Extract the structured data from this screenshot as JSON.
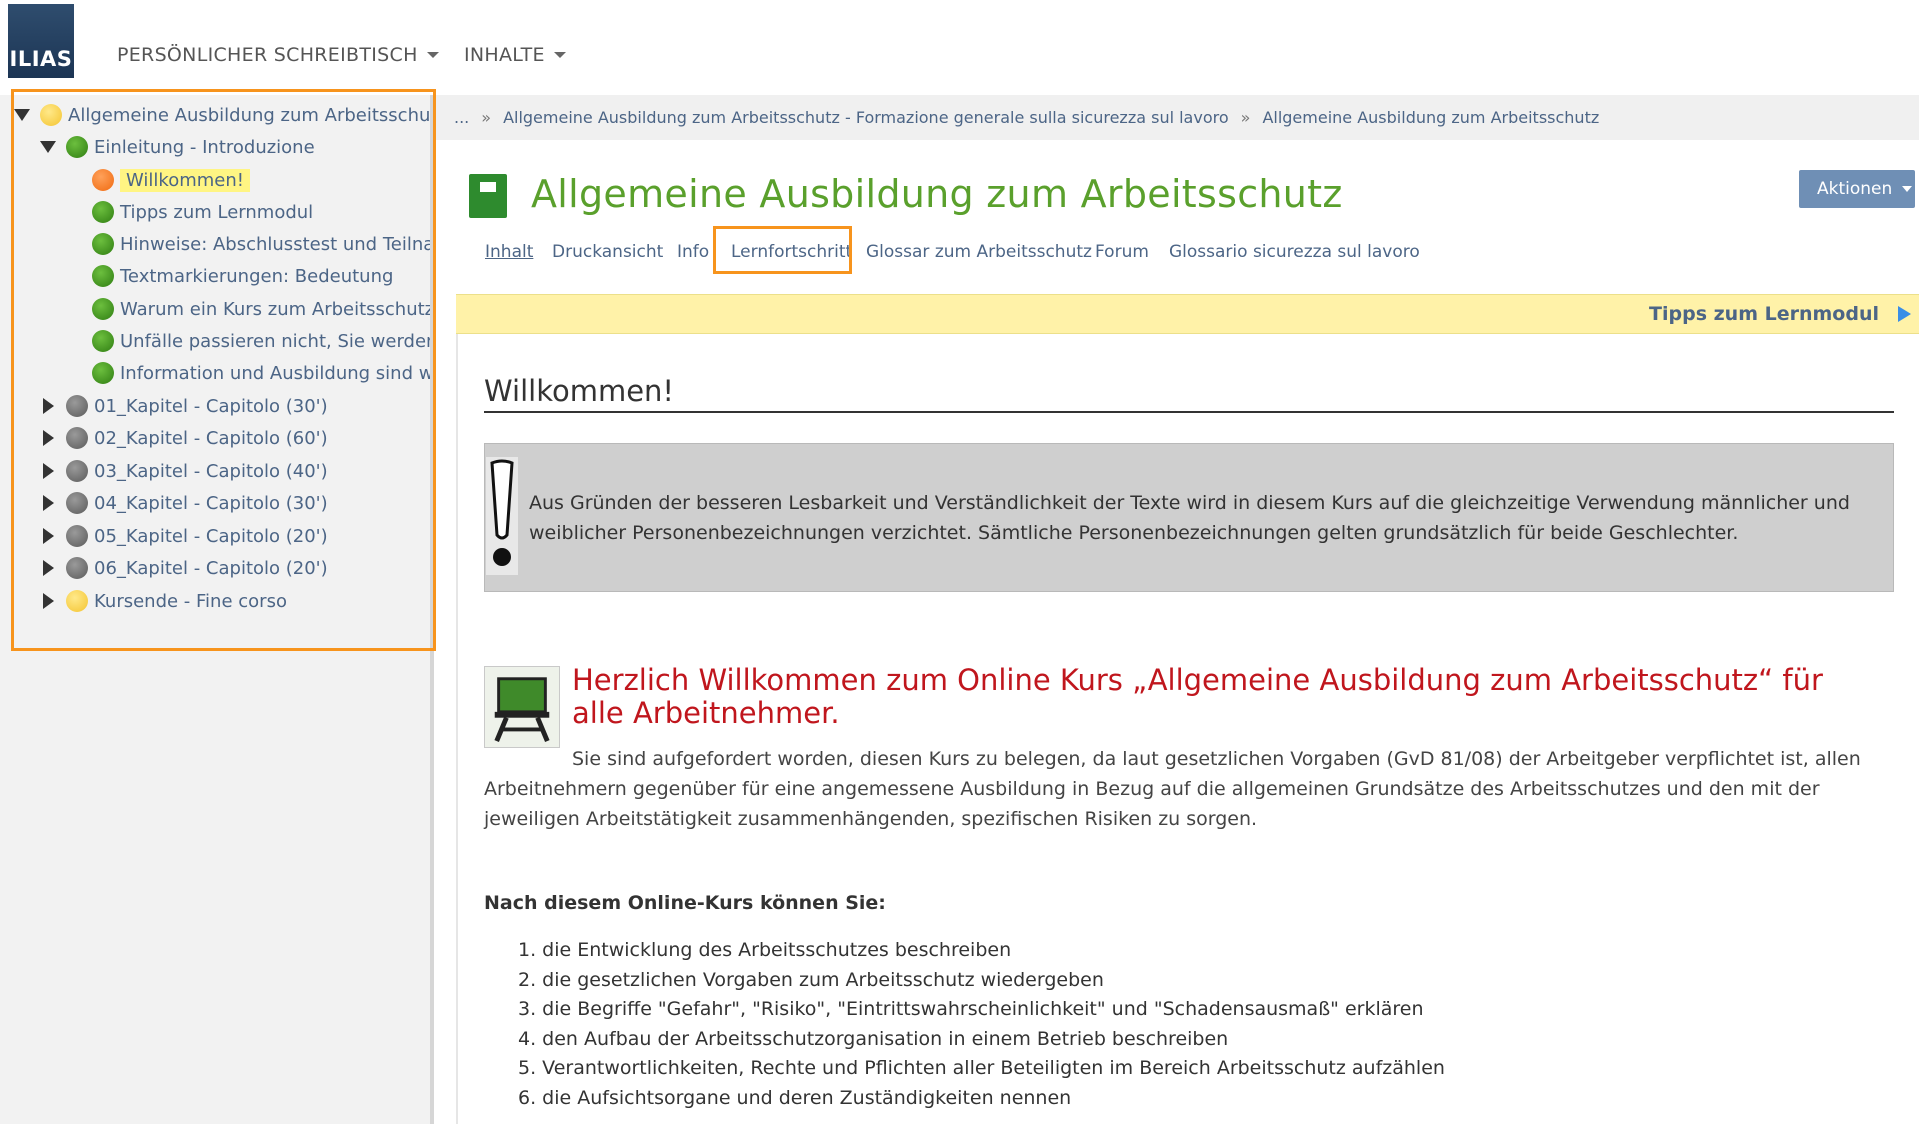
{
  "app": {
    "logo_text": "ILIAS"
  },
  "topnav": [
    {
      "label": "PERSÖNLICHER SCHREIBTISCH"
    },
    {
      "label": "INHALTE"
    }
  ],
  "tree": {
    "root": {
      "label": "Allgemeine Ausbildung zum Arbeitsschutz",
      "status": "yellow"
    },
    "chapter_intro": {
      "label": "Einleitung - Introduzione",
      "status": "green"
    },
    "pages": [
      {
        "label": "Willkommen!",
        "status": "orange",
        "current": true
      },
      {
        "label": "Tipps zum Lernmodul",
        "status": "green"
      },
      {
        "label": "Hinweise: Abschlusstest und Teilnahı",
        "status": "green"
      },
      {
        "label": "Textmarkierungen: Bedeutung",
        "status": "green"
      },
      {
        "label": "Warum ein Kurs zum Arbeitsschutz?",
        "status": "green"
      },
      {
        "label": "Unfälle passieren nicht, Sie werden v",
        "status": "green"
      },
      {
        "label": "Information und Ausbildung sind wic",
        "status": "green"
      }
    ],
    "chapters": [
      {
        "label": "01_Kapitel - Capitolo (30')",
        "status": "grey"
      },
      {
        "label": "02_Kapitel - Capitolo (60')",
        "status": "grey"
      },
      {
        "label": "03_Kapitel - Capitolo (40')",
        "status": "grey"
      },
      {
        "label": "04_Kapitel - Capitolo (30')",
        "status": "grey"
      },
      {
        "label": "05_Kapitel - Capitolo (20')",
        "status": "grey"
      },
      {
        "label": "06_Kapitel - Capitolo (20')",
        "status": "grey"
      },
      {
        "label": "Kursende - Fine corso",
        "status": "yellow"
      }
    ]
  },
  "breadcrumb": {
    "ellipsis": "...",
    "separator": "»",
    "items": [
      "Allgemeine Ausbildung zum Arbeitsschutz - Formazione generale sulla sicurezza sul lavoro",
      "Allgemeine Ausbildung zum Arbeitsschutz"
    ]
  },
  "header": {
    "title": "Allgemeine Ausbildung zum Arbeitsschutz",
    "actions_label": "Aktionen"
  },
  "tabs": [
    {
      "label": "Inhalt",
      "active": true
    },
    {
      "label": "Druckansicht"
    },
    {
      "label": "Info"
    },
    {
      "label": "Lernfortschritt"
    },
    {
      "label": "Glossar zum Arbeitsschutz"
    },
    {
      "label": "Forum"
    },
    {
      "label": "Glossario sicurezza sul lavoro"
    }
  ],
  "page_nav": {
    "next_label": "Tipps zum Lernmodul"
  },
  "page": {
    "heading": "Willkommen!",
    "note": "Aus Gründen der besseren Lesbarkeit und Verständlichkeit der Texte wird in diesem Kurs auf die gleichzeitige Verwendung männlicher und weiblicher Personenbezeichnungen verzichtet. Sämtliche Personenbezeichnungen gelten grundsätzlich für beide Geschlechter.",
    "welcome_heading": "Herzlich Willkommen zum Online Kurs „Allgemeine Ausbildung zum Arbeitsschutz“ für alle Arbeitnehmer.",
    "intro": "Sie sind aufgefordert worden, diesen Kurs zu belegen, da laut gesetzlichen Vorgaben (GvD 81/08) der Arbeitgeber verpflichtet ist, allen Arbeitnehmern gegenüber für eine angemessene Ausbildung in Bezug auf die allgemeinen Grundsätze des Arbeitsschutzes und den mit der jeweiligen Arbeitstätigkeit zusammenhängenden, spezifischen Risiken zu sorgen.",
    "goals_heading": "Nach diesem Online-Kurs können Sie:",
    "goals": [
      "1. die Entwicklung des Arbeitsschutzes beschreiben",
      "2. die gesetzlichen Vorgaben zum Arbeitsschutz wiedergeben",
      "3. die Begriffe \"Gefahr\", \"Risiko\", \"Eintrittswahrscheinlichkeit\" und \"Schadensausmaß\" erklären",
      "4. den Aufbau der Arbeitsschutzorganisation in einem Betrieb beschreiben",
      "5. Verantwortlichkeiten, Rechte und Pflichten aller Beteiligten im Bereich Arbeitsschutz aufzählen",
      "6. die Aufsichtsorgane und deren Zuständigkeiten nennen"
    ]
  },
  "colors": {
    "highlight_frame": "#f7941d",
    "title_green": "#5aa02c",
    "heading_red": "#c0161d",
    "link_blue": "#4c6586",
    "nav_yellow": "#fff2a8"
  }
}
